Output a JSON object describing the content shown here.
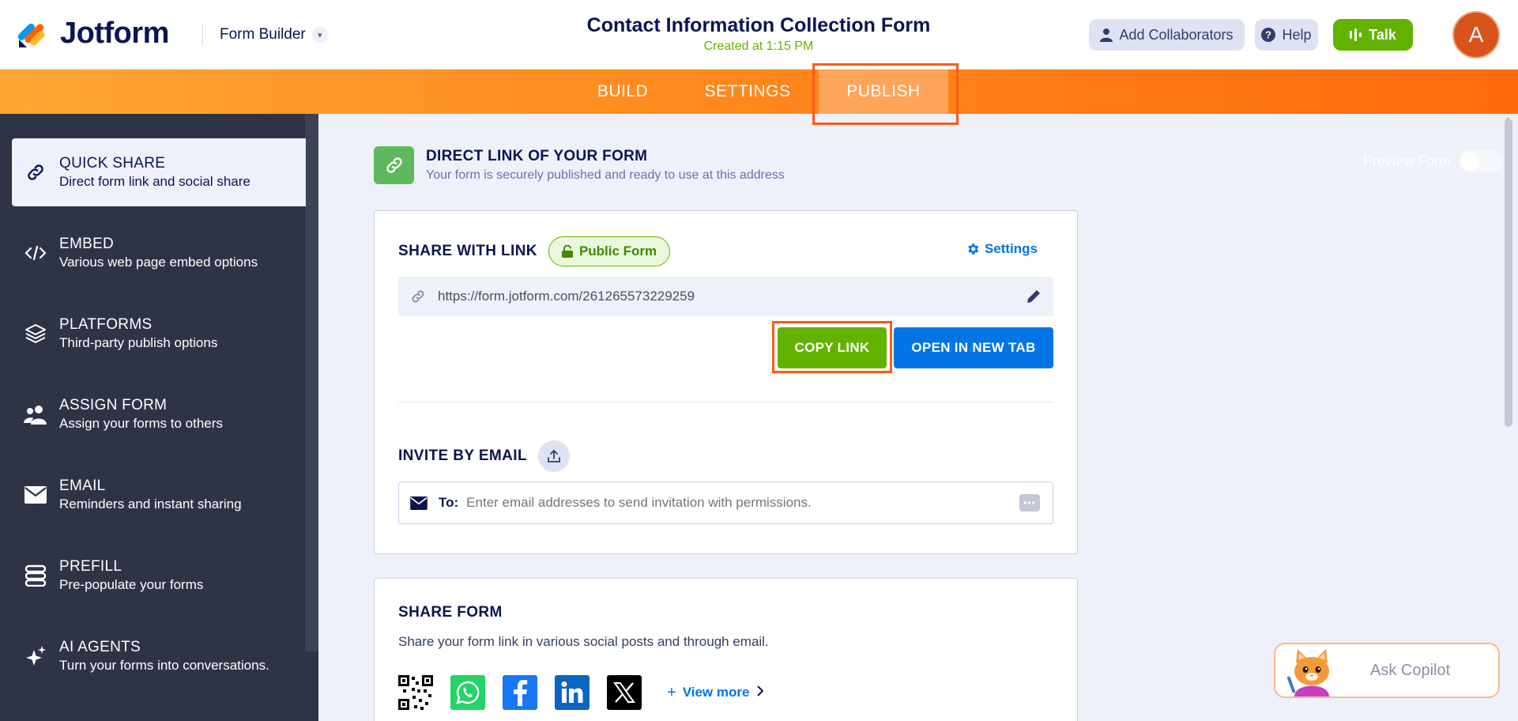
{
  "header": {
    "logo_text": "Jotform",
    "builder_label": "Form Builder",
    "form_title": "Contact Information Collection Form",
    "form_subtitle": "Created at 1:15 PM",
    "add_collaborators": "Add Collaborators",
    "help": "Help",
    "talk": "Talk",
    "avatar_initial": "A"
  },
  "tabs": {
    "build": "BUILD",
    "settings": "SETTINGS",
    "publish": "PUBLISH",
    "active": "PUBLISH"
  },
  "preview": {
    "label": "Preview Form",
    "enabled": false
  },
  "sidebar": {
    "items": [
      {
        "title": "QUICK SHARE",
        "desc": "Direct form link and social share",
        "icon": "link-icon",
        "active": true
      },
      {
        "title": "EMBED",
        "desc": "Various web page embed options",
        "icon": "code-icon"
      },
      {
        "title": "PLATFORMS",
        "desc": "Third-party publish options",
        "icon": "layers-icon"
      },
      {
        "title": "ASSIGN FORM",
        "desc": "Assign your forms to others",
        "icon": "users-icon"
      },
      {
        "title": "EMAIL",
        "desc": "Reminders and instant sharing",
        "icon": "envelope-icon"
      },
      {
        "title": "PREFILL",
        "desc": "Pre-populate your forms",
        "icon": "database-icon"
      },
      {
        "title": "AI AGENTS",
        "desc": "Turn your forms into conversations.",
        "icon": "sparkle-icon"
      }
    ]
  },
  "direct_link": {
    "title": "DIRECT LINK OF YOUR FORM",
    "desc": "Your form is securely published and ready to use at this address"
  },
  "share_link": {
    "title": "SHARE WITH LINK",
    "badge": "Public Form",
    "settings": "Settings",
    "url": "https://form.jotform.com/261265573229259",
    "copy_button": "COPY LINK",
    "open_button": "OPEN IN NEW TAB"
  },
  "invite": {
    "title": "INVITE BY EMAIL",
    "to_label": "To:",
    "placeholder": "Enter email addresses to send invitation with permissions."
  },
  "share_form": {
    "title": "SHARE FORM",
    "desc": "Share your form link in various social posts and through email.",
    "view_more": "View more",
    "networks": [
      "qr-code-icon",
      "whatsapp-icon",
      "facebook-icon",
      "linkedin-icon",
      "x-icon"
    ]
  },
  "copilot": {
    "label": "Ask Copilot"
  },
  "colors": {
    "brand_orange": "#ff6a0c",
    "green": "#64b200",
    "blue": "#0075e3",
    "navy": "#0a1551",
    "sidebar": "#2f3346"
  }
}
